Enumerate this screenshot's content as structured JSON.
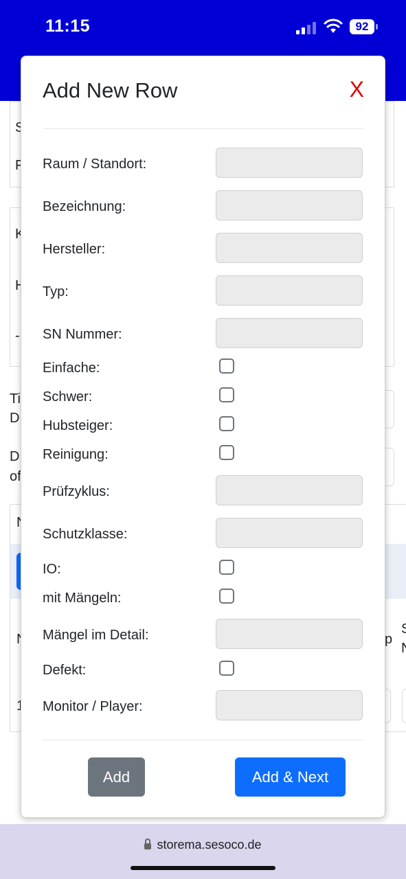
{
  "status": {
    "time": "11:15",
    "battery": "92"
  },
  "background": {
    "fragments": [
      "S",
      "F",
      "K",
      "H",
      "-",
      "Ti",
      "D",
      "D",
      "of",
      "N",
      "N",
      "1",
      "S",
      "N",
      "p"
    ]
  },
  "modal": {
    "title": "Add New Row",
    "close_label": "X",
    "fields": [
      {
        "label": "Raum / Standort:",
        "type": "input"
      },
      {
        "label": "Bezeichnung:",
        "type": "input"
      },
      {
        "label": "Hersteller:",
        "type": "input"
      },
      {
        "label": "Typ:",
        "type": "input"
      },
      {
        "label": "SN Nummer:",
        "type": "input"
      },
      {
        "label": "Einfache:",
        "type": "checkbox"
      },
      {
        "label": "Schwer:",
        "type": "checkbox"
      },
      {
        "label": "Hubsteiger:",
        "type": "checkbox"
      },
      {
        "label": "Reinigung:",
        "type": "checkbox"
      },
      {
        "label": "Prüfzyklus:",
        "type": "input"
      },
      {
        "label": "Schutzklasse:",
        "type": "input"
      },
      {
        "label": "IO:",
        "type": "checkbox"
      },
      {
        "label": "mit Mängeln:",
        "type": "checkbox"
      },
      {
        "label": "Mängel im Detail:",
        "type": "input"
      },
      {
        "label": "Defekt:",
        "type": "checkbox"
      },
      {
        "label": "Monitor / Player:",
        "type": "input"
      }
    ],
    "add_label": "Add",
    "add_next_label": "Add & Next"
  },
  "browser": {
    "url": "storema.sesoco.de"
  },
  "colors": {
    "header_blue": "#0000d6",
    "primary": "#0d6efd",
    "secondary": "#6c757d",
    "close_red": "#e00000"
  }
}
